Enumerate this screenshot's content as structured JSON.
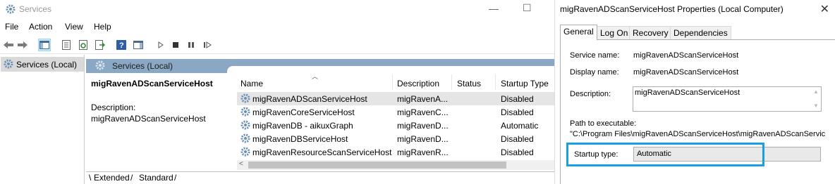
{
  "services_window": {
    "title": "Services",
    "menu": [
      "File",
      "Action",
      "View",
      "Help"
    ],
    "tree": {
      "selected_item": "Services (Local)"
    },
    "pane_header": "Services (Local)",
    "detail": {
      "service_name": "migRavenADScanServiceHost",
      "description_label": "Description:",
      "description_value": "migRavenADScanServiceHost"
    },
    "columns": [
      "Name",
      "Description",
      "Status",
      "Startup Type"
    ],
    "rows": [
      {
        "name": "migRavenADScanServiceHost",
        "description": "migRavenA...",
        "status": "",
        "startup": "Disabled"
      },
      {
        "name": "migRavenCoreServiceHost",
        "description": "migRavenC...",
        "status": "",
        "startup": "Disabled"
      },
      {
        "name": "migRavenDB - aikuxGraph",
        "description": "migRavenD...",
        "status": "",
        "startup": "Automatic"
      },
      {
        "name": "migRavenDBServiceHost",
        "description": "migRavenD...",
        "status": "",
        "startup": "Disabled"
      },
      {
        "name": "migRavenResourceScanServiceHost",
        "description": "migRavenR...",
        "status": "",
        "startup": "Disabled"
      }
    ],
    "bottom_tabs": [
      "Extended",
      "Standard"
    ]
  },
  "properties_dialog": {
    "title": "migRavenADScanServiceHost Properties (Local Computer)",
    "tabs": [
      "General",
      "Log On",
      "Recovery",
      "Dependencies"
    ],
    "active_tab": "General",
    "service_name_label": "Service name:",
    "service_name_value": "migRavenADScanServiceHost",
    "display_name_label": "Display name:",
    "display_name_value": "migRavenADScanServiceHost",
    "description_label": "Description:",
    "description_value": "migRavenADScanServiceHost",
    "path_label": "Path to executable:",
    "path_value": "\"C:\\Program Files\\migRavenADScanServiceHost\\migRavenADScanServic",
    "startup_type_label": "Startup type:",
    "startup_type_value": "Automatic",
    "highlight_color": "#1a9ee5"
  }
}
